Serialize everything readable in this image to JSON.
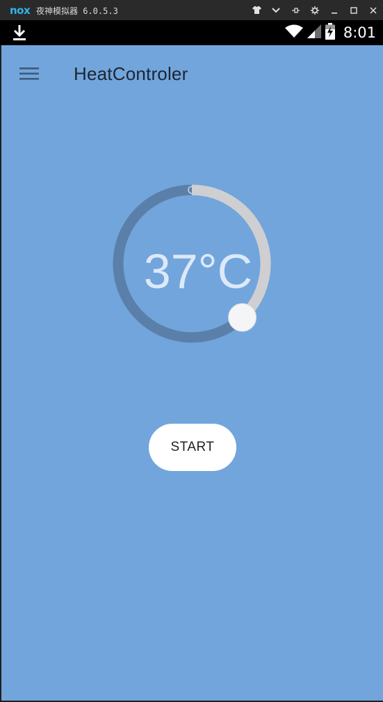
{
  "emulator": {
    "logo": "nox",
    "title": "夜神模拟器 6.0.5.3",
    "controls": [
      "shirt-icon",
      "chevron-down-icon",
      "pin-icon",
      "gear-icon",
      "minimize-icon",
      "maximize-icon",
      "close-icon"
    ]
  },
  "status_bar": {
    "time": "8:01",
    "icons": [
      "download-icon",
      "wifi-icon",
      "signal-icon",
      "battery-charging-icon"
    ]
  },
  "app": {
    "title": "HeatControler",
    "temperature": "37°C",
    "dial_level": 0.62,
    "start_label": "START",
    "colors": {
      "background": "#72a5dc",
      "track": "#cfcfd2",
      "progress": "#5a80aa",
      "knob": "#f4f5f7"
    }
  }
}
